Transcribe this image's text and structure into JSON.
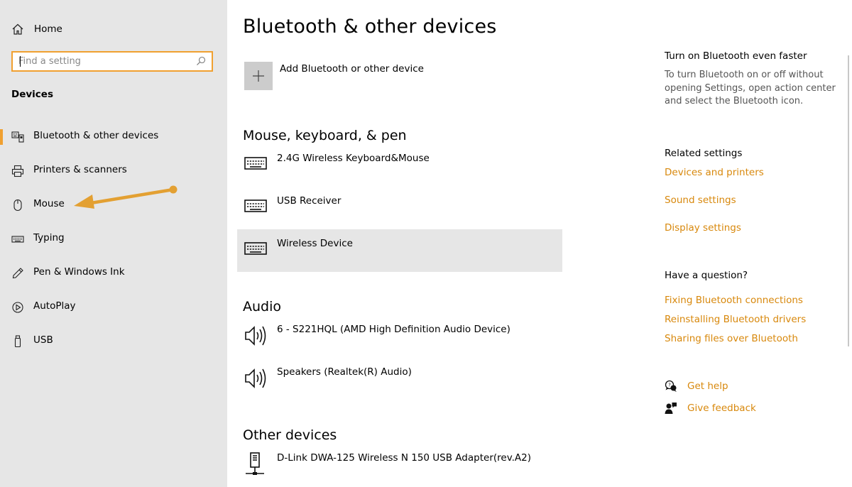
{
  "sidebar": {
    "home_label": "Home",
    "search_placeholder": "Find a setting",
    "section_title": "Devices",
    "items": [
      {
        "label": "Bluetooth & other devices",
        "icon": "bluetooth-devices-icon",
        "active": true
      },
      {
        "label": "Printers & scanners",
        "icon": "printer-icon"
      },
      {
        "label": "Mouse",
        "icon": "mouse-icon"
      },
      {
        "label": "Typing",
        "icon": "keyboard-icon"
      },
      {
        "label": "Pen & Windows Ink",
        "icon": "pen-icon"
      },
      {
        "label": "AutoPlay",
        "icon": "autoplay-icon"
      },
      {
        "label": "USB",
        "icon": "usb-icon"
      }
    ]
  },
  "main": {
    "title": "Bluetooth & other devices",
    "add_device_label": "Add Bluetooth or other device",
    "groups": [
      {
        "title": "Mouse, keyboard, & pen",
        "devices": [
          "2.4G Wireless Keyboard&Mouse",
          "USB Receiver",
          "Wireless Device"
        ]
      },
      {
        "title": "Audio",
        "devices": [
          "6 - S221HQL (AMD High Definition Audio Device)",
          "Speakers (Realtek(R) Audio)"
        ]
      },
      {
        "title": "Other devices",
        "devices": [
          "D-Link DWA-125 Wireless N 150 USB Adapter(rev.A2)"
        ]
      }
    ]
  },
  "right": {
    "tip_title": "Turn on Bluetooth even faster",
    "tip_text": "To turn Bluetooth on or off without opening Settings, open action center and select the Bluetooth icon.",
    "related_title": "Related settings",
    "related_links": [
      "Devices and printers",
      "Sound settings",
      "Display settings"
    ],
    "question_title": "Have a question?",
    "question_links": [
      "Fixing Bluetooth connections",
      "Reinstalling Bluetooth drivers",
      "Sharing files over Bluetooth"
    ],
    "get_help": "Get help",
    "give_feedback": "Give feedback"
  },
  "colors": {
    "accent": "#d8880c",
    "annotation_arrow": "#e3a032",
    "sidebar_bg": "#e6e6e6",
    "selected_bg": "#e6e6e6"
  }
}
